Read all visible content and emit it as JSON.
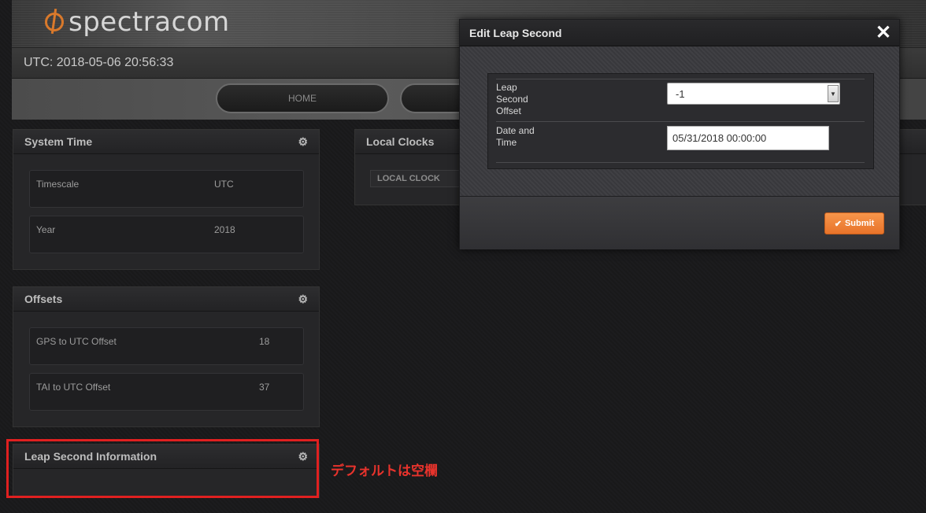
{
  "brand": {
    "name": "spectracom",
    "accent": "#d9792b"
  },
  "status": {
    "utc": "UTC: 2018-05-06 20:56:33"
  },
  "nav": {
    "home": "HOME"
  },
  "system_time": {
    "title": "System Time",
    "rows": [
      {
        "label": "Timescale",
        "value": "UTC"
      },
      {
        "label": "Year",
        "value": "2018"
      }
    ]
  },
  "offsets": {
    "title": "Offsets",
    "rows": [
      {
        "label": "GPS to UTC Offset",
        "value": "18"
      },
      {
        "label": "TAI to UTC Offset",
        "value": "37"
      }
    ]
  },
  "leap_info": {
    "title": "Leap Second Information"
  },
  "local_clocks": {
    "title": "Local Clocks",
    "column": "LOCAL CLOCK"
  },
  "annotation": {
    "text": "デフォルトは空欄",
    "color": "#e8332c"
  },
  "modal": {
    "title": "Edit Leap Second",
    "close": "✕",
    "offset_label": "Leap\nSecond\nOffset",
    "offset_value": "-1",
    "datetime_label": "Date and\nTime",
    "datetime_value": "05/31/2018 00:00:00",
    "submit": "Submit",
    "submit_color": "#f08a3a"
  }
}
